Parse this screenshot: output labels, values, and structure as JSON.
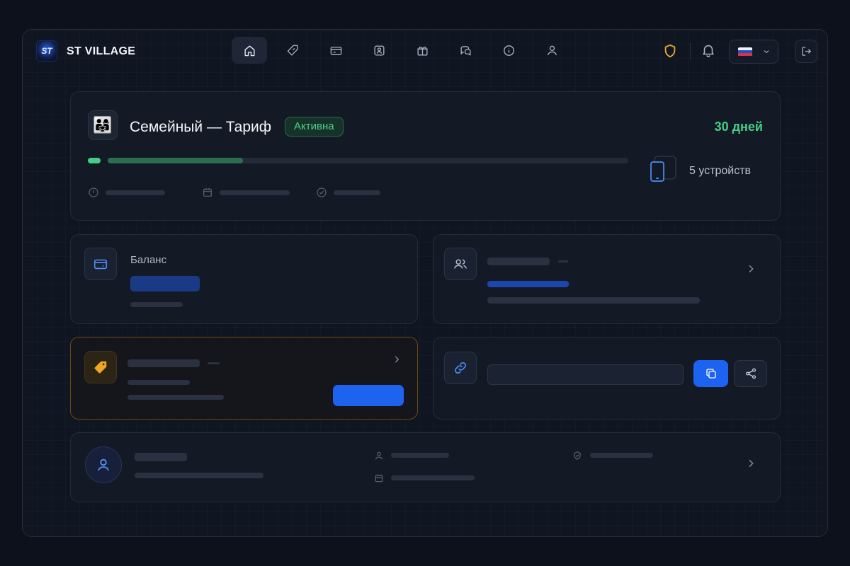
{
  "header": {
    "logo_text": "ST",
    "brand": "ST VILLAGE",
    "nav": [
      {
        "icon": "home-icon",
        "active": true
      },
      {
        "icon": "diamond-icon",
        "active": false
      },
      {
        "icon": "credit-card-icon",
        "active": false
      },
      {
        "icon": "contact-card-icon",
        "active": false
      },
      {
        "icon": "gift-icon",
        "active": false
      },
      {
        "icon": "chat-icon",
        "active": false
      },
      {
        "icon": "info-icon",
        "active": false
      },
      {
        "icon": "user-icon",
        "active": false
      }
    ],
    "language_flag": "russia-flag"
  },
  "plan": {
    "avatar_emoji": "👨‍👩‍👧",
    "title": "Семейный — Тариф",
    "status": "Активна",
    "days_left": "30 дней",
    "progress": 0.26,
    "devices": "5 устройств"
  },
  "balance": {
    "label": "Баланс"
  },
  "colors": {
    "accent_blue": "#1e63f0",
    "success_green": "#45cf86",
    "warning_amber": "#e3a92f"
  }
}
